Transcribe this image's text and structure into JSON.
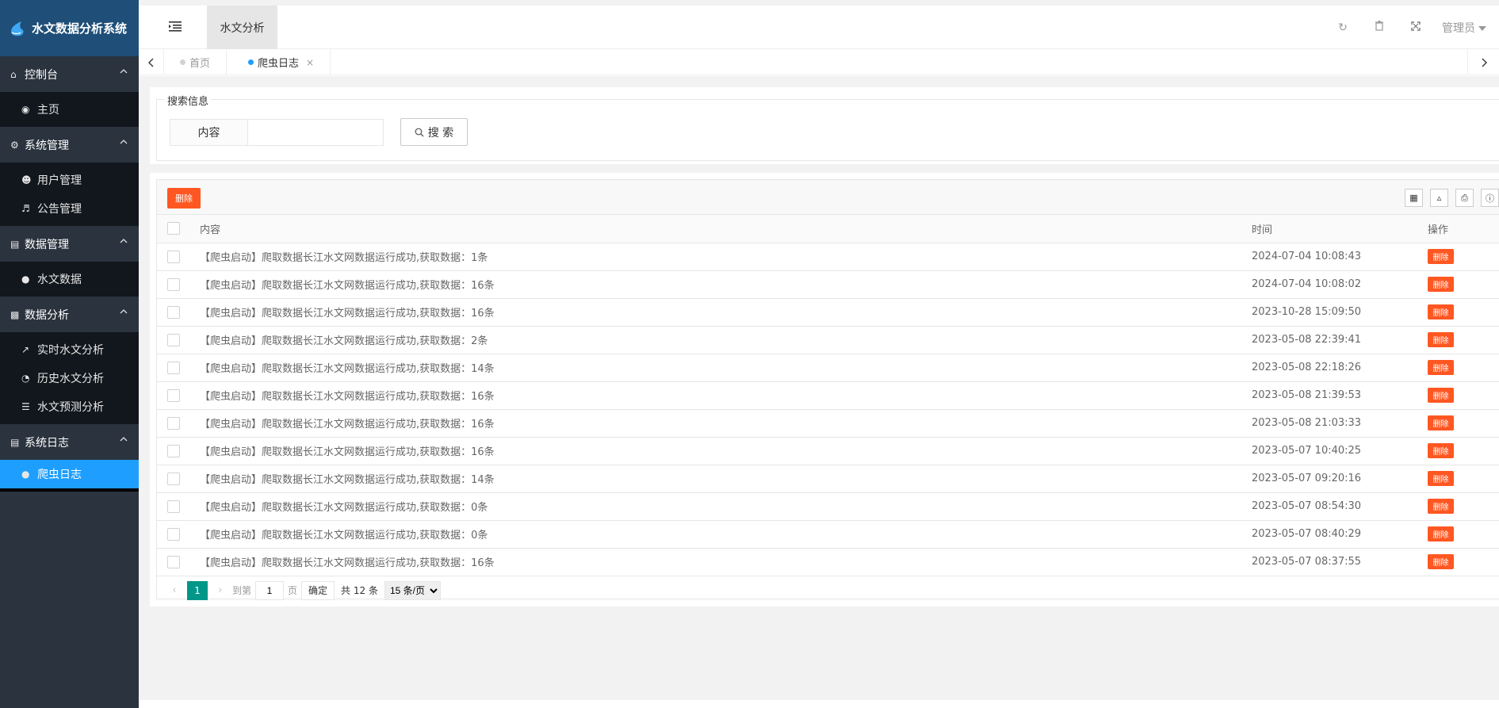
{
  "app": {
    "title": "水文数据分析系统"
  },
  "sidebar": {
    "groups": [
      {
        "label": "控制台",
        "icon": "home-icon",
        "items": [
          {
            "label": "主页",
            "icon": "dashboard-icon"
          }
        ]
      },
      {
        "label": "系统管理",
        "icon": "cogs-icon",
        "items": [
          {
            "label": "用户管理",
            "icon": "users-icon"
          },
          {
            "label": "公告管理",
            "icon": "volume-icon"
          }
        ]
      },
      {
        "label": "数据管理",
        "icon": "server-icon",
        "items": [
          {
            "label": "水文数据",
            "icon": "globe-icon"
          }
        ]
      },
      {
        "label": "数据分析",
        "icon": "bar-chart-icon",
        "items": [
          {
            "label": "实时水文分析",
            "icon": "line-chart-icon"
          },
          {
            "label": "历史水文分析",
            "icon": "pie-chart-icon"
          },
          {
            "label": "水文预测分析",
            "icon": "database-icon"
          }
        ]
      },
      {
        "label": "系统日志",
        "icon": "server-icon",
        "items": [
          {
            "label": "爬虫日志",
            "icon": "globe-icon",
            "active": true
          }
        ]
      }
    ]
  },
  "header": {
    "active_tab": "水文分析",
    "user": "管理员",
    "icons": [
      "refresh-icon",
      "trash-icon",
      "fullscreen-icon"
    ]
  },
  "tabs": [
    {
      "label": "首页"
    },
    {
      "label": "爬虫日志",
      "active": true,
      "close": "×"
    }
  ],
  "search": {
    "legend": "搜索信息",
    "label": "内容",
    "value": "",
    "button": "搜 索"
  },
  "table": {
    "delete_button": "删除",
    "columns": {
      "content": "内容",
      "time": "时间",
      "op": "操作"
    },
    "row_delete_label": "删除",
    "rows": [
      {
        "content": "【爬虫启动】爬取数据长江水文网数据运行成功,获取数据：1条",
        "time": "2024-07-04 10:08:43"
      },
      {
        "content": "【爬虫启动】爬取数据长江水文网数据运行成功,获取数据：16条",
        "time": "2024-07-04 10:08:02"
      },
      {
        "content": "【爬虫启动】爬取数据长江水文网数据运行成功,获取数据：16条",
        "time": "2023-10-28 15:09:50"
      },
      {
        "content": "【爬虫启动】爬取数据长江水文网数据运行成功,获取数据：2条",
        "time": "2023-05-08 22:39:41"
      },
      {
        "content": "【爬虫启动】爬取数据长江水文网数据运行成功,获取数据：14条",
        "time": "2023-05-08 22:18:26"
      },
      {
        "content": "【爬虫启动】爬取数据长江水文网数据运行成功,获取数据：16条",
        "time": "2023-05-08 21:39:53"
      },
      {
        "content": "【爬虫启动】爬取数据长江水文网数据运行成功,获取数据：16条",
        "time": "2023-05-08 21:03:33"
      },
      {
        "content": "【爬虫启动】爬取数据长江水文网数据运行成功,获取数据：16条",
        "time": "2023-05-07 10:40:25"
      },
      {
        "content": "【爬虫启动】爬取数据长江水文网数据运行成功,获取数据：14条",
        "time": "2023-05-07 09:20:16"
      },
      {
        "content": "【爬虫启动】爬取数据长江水文网数据运行成功,获取数据：0条",
        "time": "2023-05-07 08:54:30"
      },
      {
        "content": "【爬虫启动】爬取数据长江水文网数据运行成功,获取数据：0条",
        "time": "2023-05-07 08:40:29"
      },
      {
        "content": "【爬虫启动】爬取数据长江水文网数据运行成功,获取数据：16条",
        "time": "2023-05-07 08:37:55"
      }
    ]
  },
  "pager": {
    "current": "1",
    "goto_label": "到第",
    "goto_value": "1",
    "page_label": "页",
    "ok": "确定",
    "total": "共 12 条",
    "size_options": [
      "15 条/页"
    ]
  },
  "colors": {
    "sidebar_bg": "#2a333e",
    "logo_bg": "#1f4f78",
    "active_blue": "#1e9fff",
    "danger": "#ff5722",
    "pager_teal": "#009688"
  }
}
